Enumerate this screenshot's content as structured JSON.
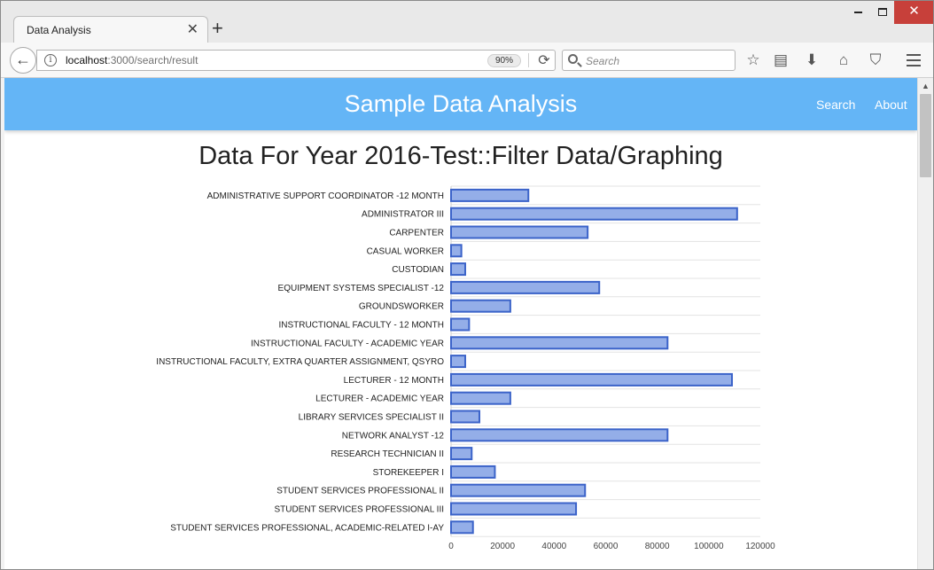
{
  "browser": {
    "tab_title": "Data Analysis",
    "tab_close": "✕",
    "new_tab": "+",
    "url_host": "localhost",
    "url_path": ":3000/search/result",
    "zoom": "90%",
    "search_placeholder": "Search",
    "icons": [
      "back-arrow-icon",
      "info-icon",
      "reload-icon",
      "search-icon",
      "bookmark-star-icon",
      "reading-list-icon",
      "download-icon",
      "home-icon",
      "pocket-icon",
      "hamburger-menu-icon"
    ]
  },
  "app": {
    "title": "Sample Data Analysis",
    "nav": {
      "search": "Search",
      "about": "About"
    },
    "accent": "#64b5f6"
  },
  "page": {
    "title": "Data For Year 2016-Test::Filter Data/Graphing"
  },
  "chart_data": {
    "type": "bar",
    "orientation": "horizontal",
    "title": "",
    "xlabel": "",
    "ylabel": "",
    "xlim": [
      0,
      120000
    ],
    "xticks": [
      0,
      20000,
      40000,
      60000,
      80000,
      100000,
      120000
    ],
    "grid": true,
    "bar_color": "#94aee8",
    "bar_border": "#3b63c9",
    "categories": [
      "ADMINISTRATIVE SUPPORT COORDINATOR -12 MONTH",
      "ADMINISTRATOR III",
      "CARPENTER",
      "CASUAL WORKER",
      "CUSTODIAN",
      "EQUIPMENT SYSTEMS SPECIALIST -12",
      "GROUNDSWORKER",
      "INSTRUCTIONAL FACULTY - 12 MONTH",
      "INSTRUCTIONAL FACULTY - ACADEMIC YEAR",
      "INSTRUCTIONAL FACULTY, EXTRA QUARTER ASSIGNMENT, QSYRO",
      "LECTURER - 12 MONTH",
      "LECTURER - ACADEMIC YEAR",
      "LIBRARY SERVICES SPECIALIST II",
      "NETWORK ANALYST -12",
      "RESEARCH TECHNICIAN II",
      "STOREKEEPER I",
      "STUDENT SERVICES PROFESSIONAL II",
      "STUDENT SERVICES PROFESSIONAL III",
      "STUDENT SERVICES PROFESSIONAL, ACADEMIC-RELATED I-AY"
    ],
    "values": [
      30000,
      111000,
      53000,
      4000,
      5500,
      57500,
      23000,
      7000,
      84000,
      5500,
      109000,
      23000,
      11000,
      84000,
      8000,
      17000,
      52000,
      48500,
      8500
    ]
  }
}
